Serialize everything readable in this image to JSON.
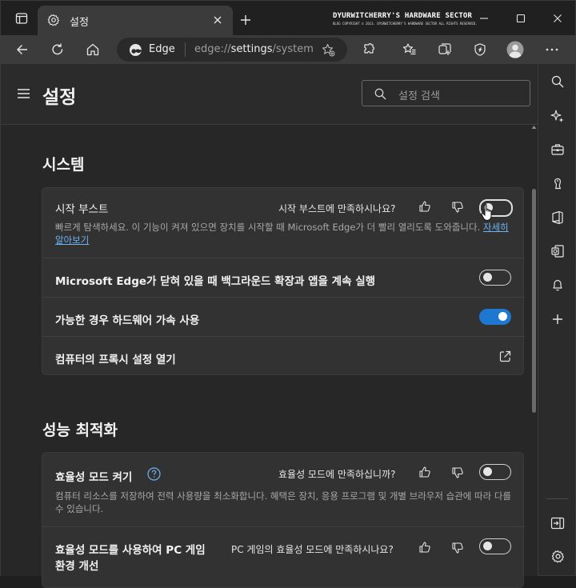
{
  "browser": {
    "tab_title": "설정",
    "watermark_line1": "DYURWITCHERRY'S HARDWARE SECTOR",
    "watermark_line2": "BLOG COPYRIGHT © 2013. DYURWITCHERRY'S HARDWARE SECTOR ALL RIGHTS RESERVED.",
    "edge_label": "Edge",
    "url_prefix": "edge://",
    "url_main": "settings",
    "url_suffix": "/system"
  },
  "header": {
    "title": "설정",
    "search_placeholder": "설정 검색"
  },
  "system_section": {
    "title": "시스템",
    "startup_boost": {
      "label": "시작 부스트",
      "feedback": "시작 부스트에 만족하시나요?",
      "description": "빠르게 탐색하세요. 이 기능이 켜져 있으면 장치를 시작할 때 Microsoft Edge가 더 빨리 열리도록 도와줍니다.",
      "link": "자세히 알아보기",
      "enabled": false
    },
    "background_apps": {
      "label": "Microsoft Edge가 닫혀 있을 때 백그라운드 확장과 앱을 계속 실행",
      "enabled": false
    },
    "hardware_accel": {
      "label": "가능한 경우 하드웨어 가속 사용",
      "enabled": true
    },
    "proxy": {
      "label": "컴퓨터의 프록시 설정 열기"
    }
  },
  "performance_section": {
    "title": "성능 최적화",
    "efficiency_mode": {
      "label": "효율성 모드 켜기",
      "feedback": "효율성 모드에 만족하십니까?",
      "description": "컴퓨터 리소스를 저장하여 전력 사용량을 최소화합니다. 혜택은 장치, 응용 프로그램 및 개별 브라우저 습관에 따라 다를 수 있습니다.",
      "enabled": false
    },
    "pc_game": {
      "label_line1": "효율성 모드를 사용하여 PC 게임",
      "label_line2": "환경 개선",
      "feedback": "PC 게임의 효율성 모드에 만족하시나요?",
      "enabled": false
    }
  },
  "colors": {
    "accent": "#1e78d0",
    "link": "#6cb4f2"
  }
}
